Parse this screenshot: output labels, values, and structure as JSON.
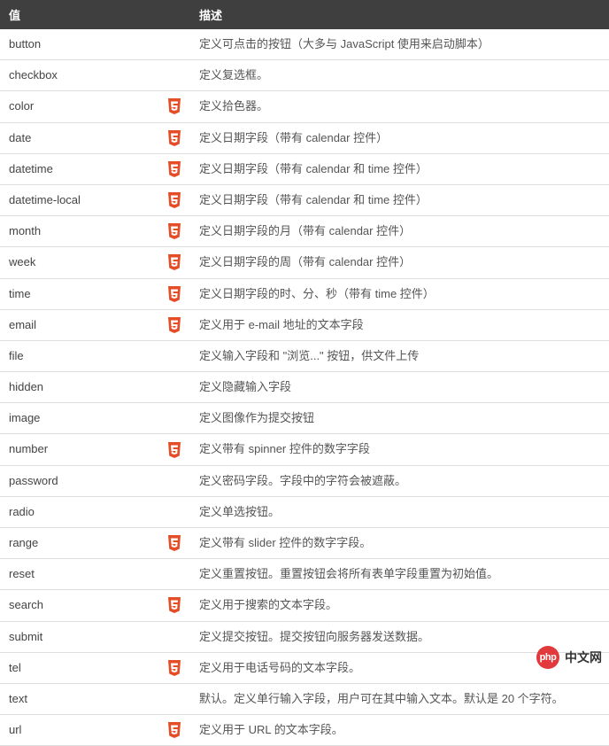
{
  "headers": {
    "value": "值",
    "desc": "描述"
  },
  "rows": [
    {
      "value": "button",
      "html5": false,
      "desc": "定义可点击的按钮（大多与 JavaScript 使用来启动脚本）"
    },
    {
      "value": "checkbox",
      "html5": false,
      "desc": "定义复选框。"
    },
    {
      "value": "color",
      "html5": true,
      "desc": "定义拾色器。"
    },
    {
      "value": "date",
      "html5": true,
      "desc": "定义日期字段（带有 calendar 控件）"
    },
    {
      "value": "datetime",
      "html5": true,
      "desc": "定义日期字段（带有 calendar 和 time 控件）"
    },
    {
      "value": "datetime-local",
      "html5": true,
      "desc": "定义日期字段（带有 calendar 和 time 控件）"
    },
    {
      "value": "month",
      "html5": true,
      "desc": "定义日期字段的月（带有 calendar 控件）"
    },
    {
      "value": "week",
      "html5": true,
      "desc": "定义日期字段的周（带有 calendar 控件）"
    },
    {
      "value": "time",
      "html5": true,
      "desc": "定义日期字段的时、分、秒（带有 time 控件）"
    },
    {
      "value": "email",
      "html5": true,
      "desc": "定义用于 e-mail 地址的文本字段"
    },
    {
      "value": "file",
      "html5": false,
      "desc": "定义输入字段和 \"浏览...\" 按钮，供文件上传"
    },
    {
      "value": "hidden",
      "html5": false,
      "desc": "定义隐藏输入字段"
    },
    {
      "value": "image",
      "html5": false,
      "desc": "定义图像作为提交按钮"
    },
    {
      "value": "number",
      "html5": true,
      "desc": "定义带有 spinner 控件的数字字段"
    },
    {
      "value": "password",
      "html5": false,
      "desc": "定义密码字段。字段中的字符会被遮蔽。"
    },
    {
      "value": "radio",
      "html5": false,
      "desc": "定义单选按钮。"
    },
    {
      "value": "range",
      "html5": true,
      "desc": "定义带有 slider 控件的数字字段。"
    },
    {
      "value": "reset",
      "html5": false,
      "desc": "定义重置按钮。重置按钮会将所有表单字段重置为初始值。"
    },
    {
      "value": "search",
      "html5": true,
      "desc": "定义用于搜索的文本字段。"
    },
    {
      "value": "submit",
      "html5": false,
      "desc": "定义提交按钮。提交按钮向服务器发送数据。"
    },
    {
      "value": "tel",
      "html5": true,
      "desc": "定义用于电话号码的文本字段。"
    },
    {
      "value": "text",
      "html5": false,
      "desc": "默认。定义单行输入字段，用户可在其中输入文本。默认是 20 个字符。"
    },
    {
      "value": "url",
      "html5": true,
      "desc": "定义用于 URL 的文本字段。"
    }
  ],
  "watermark": {
    "badge": "php",
    "text": "中文网"
  }
}
